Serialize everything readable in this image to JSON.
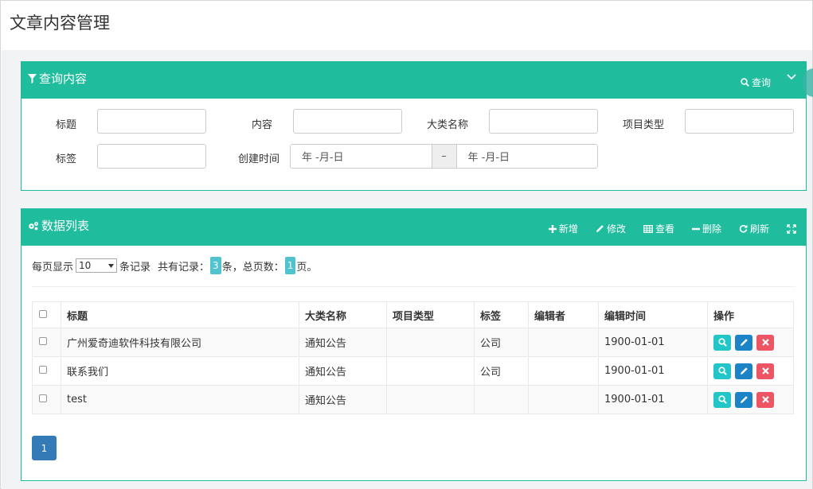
{
  "page": {
    "title": "文章内容管理"
  },
  "search": {
    "title": "查询内容",
    "query_label": "查询",
    "fields": {
      "title_label": "标题",
      "content_label": "内容",
      "category_label": "大类名称",
      "project_type_label": "项目类型",
      "tag_label": "标签",
      "created_label": "创建时间"
    },
    "date_start": "年 -月-日",
    "date_sep": "–",
    "date_end": "年 -月-日"
  },
  "list": {
    "title": "数据列表",
    "toolbar": {
      "add": "新增",
      "edit": "修改",
      "view": "查看",
      "delete": "删除",
      "refresh": "刷新"
    },
    "pager": {
      "prefix": "每页显示",
      "page_size": "10",
      "records_label": "条记录",
      "total_prefix": "共有记录：",
      "total": "3",
      "total_suffix": "条，总页数：",
      "pages": "1",
      "pages_suffix": "页。"
    },
    "columns": [
      "标题",
      "大类名称",
      "项目类型",
      "标签",
      "编辑者",
      "编辑时间",
      "操作"
    ],
    "rows": [
      {
        "title": "广州爱奇迪软件科技有限公司",
        "category": "通知公告",
        "type": "",
        "tag": "公司",
        "editor": "",
        "time": "1900-01-01"
      },
      {
        "title": "联系我们",
        "category": "通知公告",
        "type": "",
        "tag": "公司",
        "editor": "",
        "time": "1900-01-01"
      },
      {
        "title": "test",
        "category": "通知公告",
        "type": "",
        "tag": "",
        "editor": "",
        "time": "1900-01-01"
      }
    ],
    "current_page": "1"
  },
  "colors": {
    "accent": "#20bc9e",
    "primary": "#337ab7",
    "info": "#23c6c8",
    "edit": "#1c84c6",
    "danger": "#ed5565"
  }
}
